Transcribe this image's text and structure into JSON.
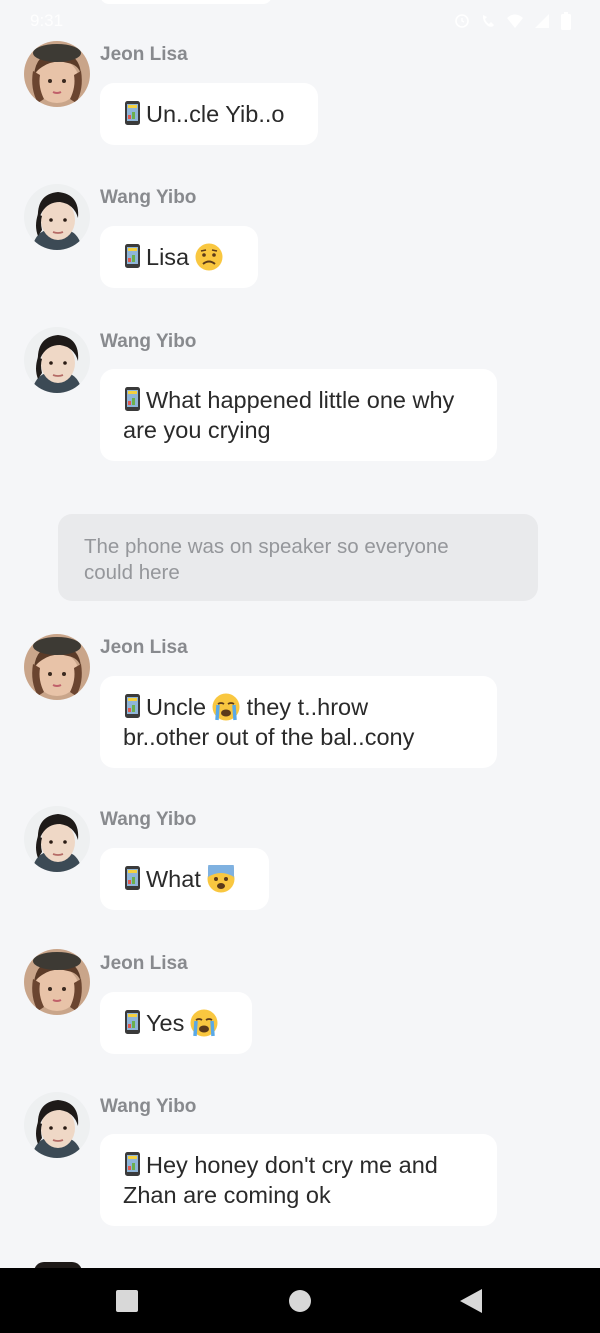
{
  "status_bar": {
    "time": "9:31",
    "icons": [
      "alarm-icon",
      "call-icon",
      "wifi-icon",
      "signal-icon",
      "battery-icon"
    ]
  },
  "messages": [
    {
      "sender": "Jeon Lisa",
      "avatar": "lisa",
      "text": "Un..cle Yib..o",
      "emoji": ""
    },
    {
      "sender": "Wang Yibo",
      "avatar": "yibo",
      "text": "Lisa",
      "emoji": "worried"
    },
    {
      "sender": "Wang Yibo",
      "avatar": "yibo",
      "text": "What happened little one why",
      "text2": "are you crying",
      "emoji": ""
    },
    {
      "sender": "Jeon Lisa",
      "avatar": "lisa",
      "text": "Uncle",
      "text_after": " they t..hrow",
      "text2": "br..other out of the bal..cony",
      "emoji": "crying"
    },
    {
      "sender": "Wang Yibo",
      "avatar": "yibo",
      "text": "What",
      "emoji": "fearful"
    },
    {
      "sender": "Jeon Lisa",
      "avatar": "lisa",
      "text": "Yes",
      "emoji": "crying"
    },
    {
      "sender": "Wang Yibo",
      "avatar": "yibo",
      "text": "Hey honey don't cry me and",
      "text2": "Zhan are coming ok",
      "emoji": ""
    }
  ],
  "narration": {
    "line1": "The phone was on speaker so everyone",
    "line2": "could here"
  },
  "nav": {
    "recent": "square-recent-icon",
    "home": "circle-home-icon",
    "back": "triangle-back-icon"
  },
  "colors": {
    "background": "#f5f6f8",
    "bubble": "#ffffff",
    "narration_bg": "#e9eaec",
    "sender": "#888a8e"
  }
}
